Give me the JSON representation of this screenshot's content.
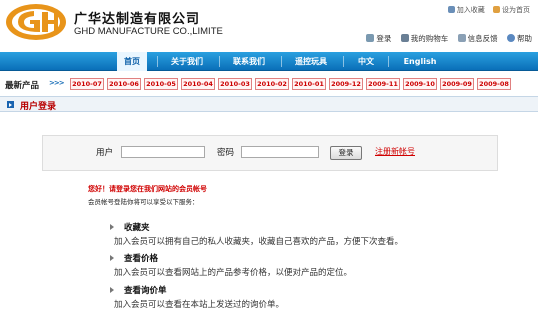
{
  "header": {
    "company_cn": "广华达制造有限公司",
    "company_en": "GHD MANUFACTURE CO.,LIMITE",
    "add_favorite": "加入收藏",
    "set_homepage": "设为首页",
    "login": "登录",
    "cart": "我的购物车",
    "feedback": "信息反馈",
    "help": "帮助"
  },
  "nav": {
    "items": [
      "首页",
      "关于我们",
      "联系我们",
      "遥控玩具",
      "中文",
      "English"
    ],
    "active_index": 0
  },
  "products": {
    "label": "最新产品",
    "arrows": ">>>",
    "dates": [
      "2010-07",
      "2010-06",
      "2010-05",
      "2010-04",
      "2010-03",
      "2010-02",
      "2010-01",
      "2009-12",
      "2009-11",
      "2009-10",
      "2009-09",
      "2009-08"
    ]
  },
  "section": {
    "title": "用户登录"
  },
  "login_form": {
    "username_label": "用户",
    "username_value": "",
    "password_label": "密码",
    "password_value": "",
    "submit_label": "登录",
    "register_label": "注册新帐号"
  },
  "notice": {
    "title": "您好！请登录您在我们网站的会员帐号",
    "subtitle": "会员帐号登陆你将可以享受以下服务："
  },
  "benefits": [
    {
      "title": "收藏夹",
      "desc": "加入会员可以拥有自己的私人收藏夹，收藏自己喜欢的产品，方便下次查看。"
    },
    {
      "title": "查看价格",
      "desc": "加入会员可以查看网站上的产品参考价格，以便对产品的定位。"
    },
    {
      "title": "查看询价单",
      "desc": "加入会员可以查看在本站上发送过的询价单。"
    }
  ],
  "colors": {
    "nav_blue": "#0a6fb8",
    "accent_red": "#d00000",
    "logo_orange": "#e8941a"
  },
  "icons": {
    "favorite": "star-icon",
    "homepage": "home-icon",
    "login": "user-icon",
    "cart": "cart-icon",
    "feedback": "message-icon",
    "help": "help-icon"
  }
}
